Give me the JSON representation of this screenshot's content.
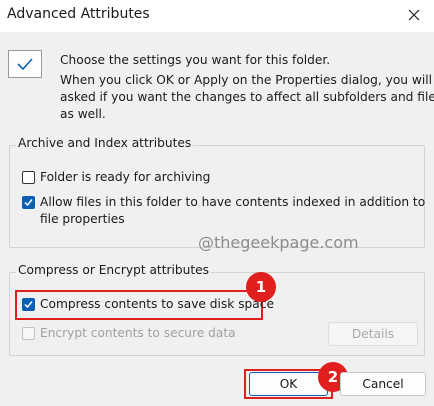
{
  "window": {
    "title": "Advanced Attributes"
  },
  "intro": {
    "line1": "Choose the settings you want for this folder.",
    "line2": "When you click OK or Apply on the Properties dialog, you will be",
    "line3": "asked if you want the changes to affect all subfolders and files",
    "line4": "as well."
  },
  "archive_group": {
    "title": "Archive and Index attributes",
    "items": [
      {
        "label": "Folder is ready for archiving",
        "checked": false
      },
      {
        "label_line1": "Allow files in this folder to have contents indexed in addition to",
        "label_line2": "file properties",
        "checked": true
      }
    ]
  },
  "watermark": "@thegeekpage.com",
  "compress_group": {
    "title": "Compress or Encrypt attributes",
    "items": [
      {
        "label": "Compress contents to save disk space",
        "checked": true
      },
      {
        "label": "Encrypt contents to secure data",
        "checked": false,
        "disabled": true
      }
    ],
    "details_button": "Details"
  },
  "annotations": {
    "step1": "1",
    "step2": "2",
    "color": "#e21f1f"
  },
  "footer": {
    "ok_label": "OK",
    "cancel_label": "Cancel"
  },
  "colors": {
    "accent": "#0a5fb4",
    "highlight": "#e21f1f"
  }
}
